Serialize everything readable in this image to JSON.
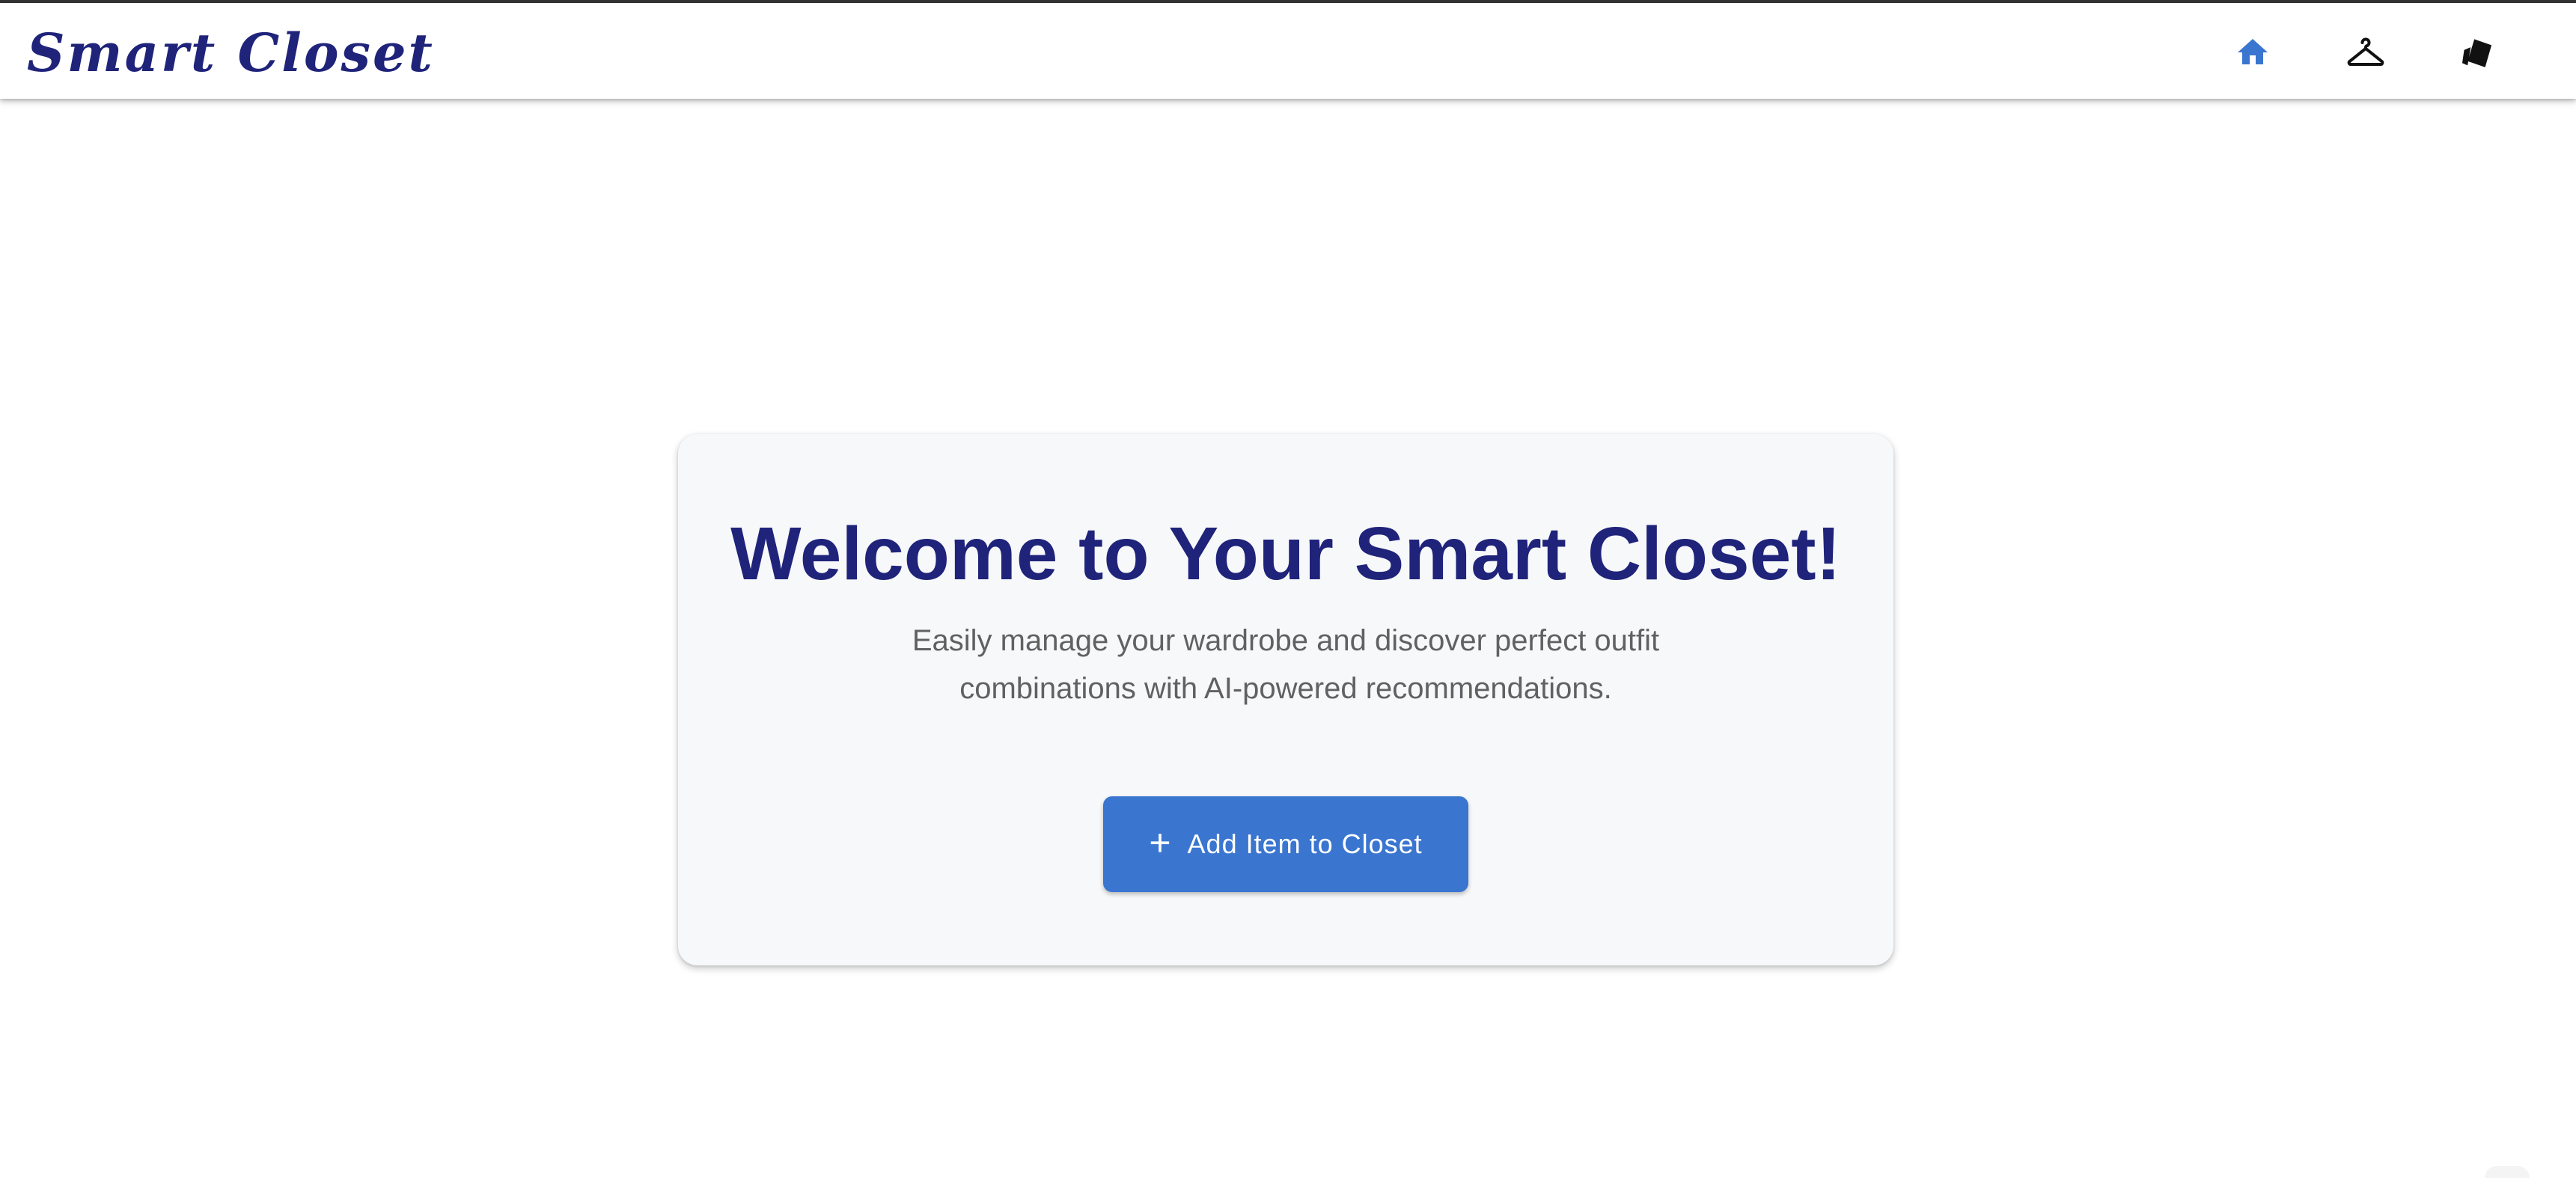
{
  "appbar": {
    "brand": "Smart Closet",
    "nav": [
      {
        "icon": "home-icon",
        "active": true
      },
      {
        "icon": "hanger-icon",
        "active": false
      },
      {
        "icon": "tags-icon",
        "active": false
      }
    ]
  },
  "hero": {
    "title": "Welcome to Your Smart Closet!",
    "subtitle": "Easily manage your wardrobe and discover perfect outfit combinations with AI-powered recommendations.",
    "add_button": {
      "icon": "plus-icon",
      "label": "Add Item to Closet"
    }
  },
  "colors": {
    "brand": "#1f237a",
    "primary": "#3a75d0",
    "card_background": "#f7f8fa",
    "subtitle_text": "#616161"
  }
}
